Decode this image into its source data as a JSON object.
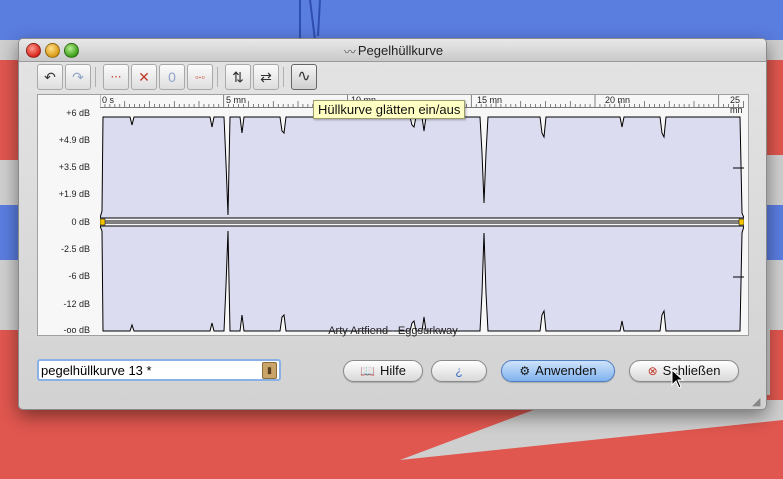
{
  "window": {
    "title": "Pegelhüllkurve"
  },
  "toolbar": {
    "buttons": [
      {
        "name": "undo",
        "icon": "undo-icon",
        "glyph": "↶"
      },
      {
        "name": "redo",
        "icon": "redo-icon",
        "glyph": "↷"
      },
      {
        "name": "add-point",
        "icon": "add-point-icon",
        "glyph": "⋯"
      },
      {
        "name": "delete-point",
        "icon": "delete-point-icon",
        "glyph": "✕"
      },
      {
        "name": "zero",
        "icon": "zero-icon",
        "glyph": "0"
      },
      {
        "name": "link-points",
        "icon": "link-icon",
        "glyph": "▫-▫"
      },
      {
        "name": "flip-vertical",
        "icon": "flip-vertical-icon",
        "glyph": "⇅"
      },
      {
        "name": "flip-horizontal",
        "icon": "flip-horizontal-icon",
        "glyph": "⇄"
      },
      {
        "name": "smooth",
        "icon": "smooth-curve-icon",
        "glyph": "∿"
      }
    ],
    "tooltip": "Hüllkurve glätten ein/aus"
  },
  "graph": {
    "ruler_labels": [
      "0 s",
      "5 mn",
      "10 mn",
      "15 mn",
      "20 mn",
      "25 mn"
    ],
    "y_labels": [
      "+6 dB",
      "+4.9 dB",
      "+3.5 dB",
      "+1.9 dB",
      "0 dB",
      "-2.5 dB",
      "-6 dB",
      "-12 dB",
      "-oo dB"
    ],
    "track_label": "Arty Artfiend - Eggsurkway",
    "colors": {
      "plot_fill": "#dcdcf0",
      "line": "#000000",
      "handle": "#f2c400"
    }
  },
  "preset": {
    "value": "pegelhüllkurve 13 *"
  },
  "buttons": {
    "help": "Hilfe",
    "apply": "Anwenden",
    "close": "Schließen"
  },
  "background": {
    "colors": {
      "blue": "#5a7de0",
      "red": "#e0574f"
    }
  }
}
